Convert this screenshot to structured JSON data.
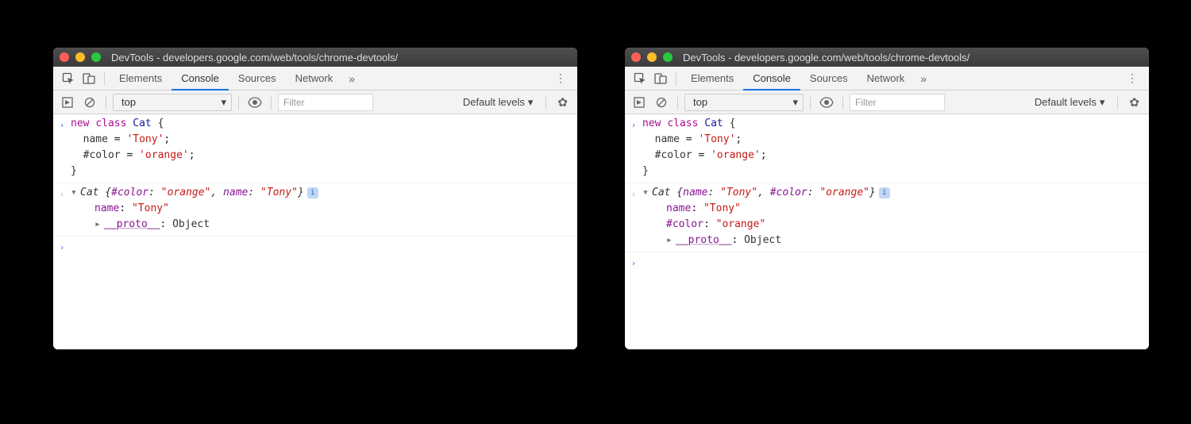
{
  "windows": [
    {
      "id": "left",
      "title": "DevTools - developers.google.com/web/tools/chrome-devtools/",
      "tabs": [
        "Elements",
        "Console",
        "Sources",
        "Network"
      ],
      "active_tab": "Console",
      "context": "top",
      "filter_placeholder": "Filter",
      "levels_label": "Default levels",
      "input_code": "new class Cat {\n  name = 'Tony';\n  #color = 'orange';\n}",
      "output": {
        "summary": "Cat {#color: \"orange\", name: \"Tony\"}",
        "lines": [
          {
            "prop": "name",
            "val": "\"Tony\"",
            "kind": "string"
          },
          {
            "prop": "__proto__",
            "val": "Object",
            "kind": "proto",
            "collapsed": true
          }
        ]
      }
    },
    {
      "id": "right",
      "title": "DevTools - developers.google.com/web/tools/chrome-devtools/",
      "tabs": [
        "Elements",
        "Console",
        "Sources",
        "Network"
      ],
      "active_tab": "Console",
      "context": "top",
      "filter_placeholder": "Filter",
      "levels_label": "Default levels",
      "input_code": "new class Cat {\n  name = 'Tony';\n  #color = 'orange';\n}",
      "output": {
        "summary": "Cat {name: \"Tony\", #color: \"orange\"}",
        "lines": [
          {
            "prop": "name",
            "val": "\"Tony\"",
            "kind": "string"
          },
          {
            "prop": "#color",
            "val": "\"orange\"",
            "kind": "string"
          },
          {
            "prop": "__proto__",
            "val": "Object",
            "kind": "proto",
            "collapsed": true
          }
        ]
      }
    }
  ]
}
